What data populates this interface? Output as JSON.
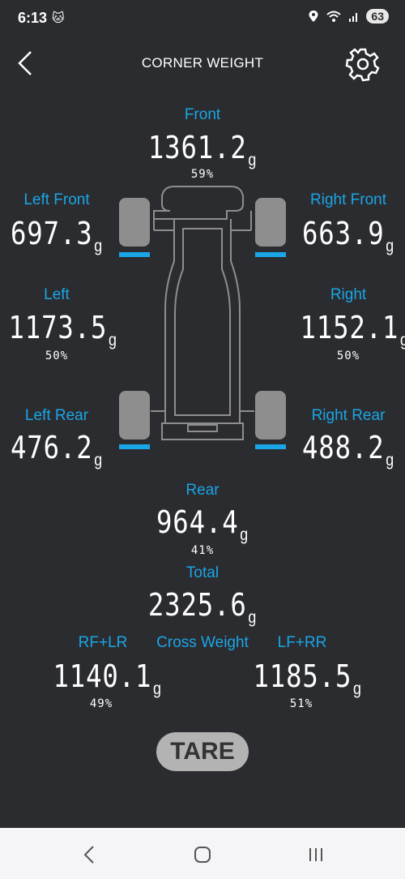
{
  "status": {
    "time": "6:13",
    "battery": "63"
  },
  "appbar": {
    "title": "CORNER WEIGHT"
  },
  "front": {
    "label": "Front",
    "value": "1361.2",
    "unit": "g",
    "percent": "59%"
  },
  "left_front": {
    "label": "Left Front",
    "value": "697.3",
    "unit": "g"
  },
  "right_front": {
    "label": "Right Front",
    "value": "663.9",
    "unit": "g"
  },
  "left": {
    "label": "Left",
    "value": "1173.5",
    "unit": "g",
    "percent": "50%"
  },
  "right": {
    "label": "Right",
    "value": "1152.1",
    "unit": "g",
    "percent": "50%"
  },
  "left_rear": {
    "label": "Left Rear",
    "value": "476.2",
    "unit": "g"
  },
  "right_rear": {
    "label": "Right Rear",
    "value": "488.2",
    "unit": "g"
  },
  "rear": {
    "label": "Rear",
    "value": "964.4",
    "unit": "g",
    "percent": "41%"
  },
  "total": {
    "label": "Total",
    "value": "2325.6",
    "unit": "g"
  },
  "cross": {
    "title": "Cross Weight",
    "rf_lr": {
      "label": "RF+LR",
      "value": "1140.1",
      "unit": "g",
      "percent": "49%"
    },
    "lf_rr": {
      "label": "LF+RR",
      "value": "1185.5",
      "unit": "g",
      "percent": "51%"
    }
  },
  "tare_label": "TARE",
  "colors": {
    "accent": "#1aa6e6",
    "background": "#2b2c30",
    "wheel": "#8e8e8e"
  },
  "icons": [
    "back-arrow-icon",
    "gear-icon",
    "nav-back-icon",
    "nav-home-icon",
    "nav-recents-icon"
  ]
}
